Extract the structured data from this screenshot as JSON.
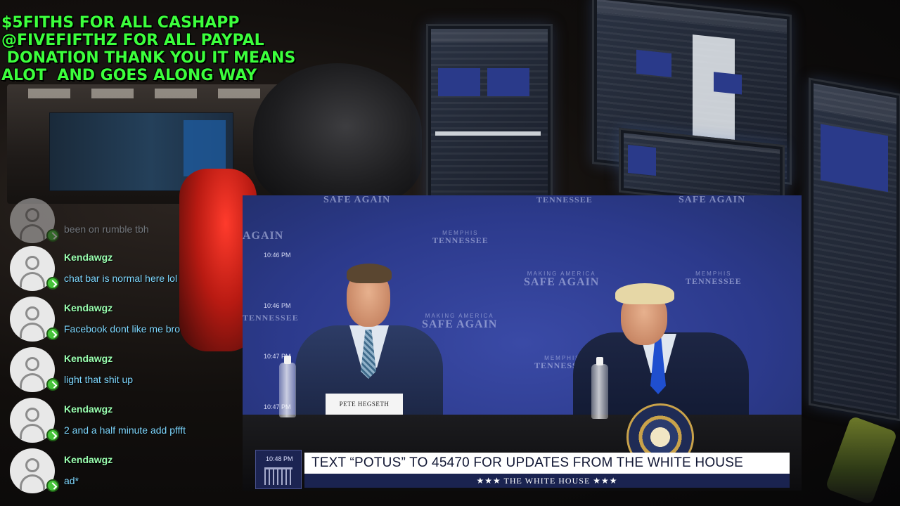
{
  "donation_overlay": {
    "lines": [
      "$5FITHS FOR ALL CASHAPP",
      "@FIVEFIFTHZ FOR ALL PAYPAL",
      " DONATION THANK YOU IT MEANS",
      "ALOT  AND GOES ALONG WAY"
    ],
    "color": "#3cff3c"
  },
  "chat": {
    "messages": [
      {
        "user": "",
        "text": "been on rumble tbh"
      },
      {
        "user": "Kendawgz",
        "text": "chat bar is normal here lol"
      },
      {
        "user": "Kendawgz",
        "text": "Facebook dont like me bro"
      },
      {
        "user": "Kendawgz",
        "text": "light that shit up"
      },
      {
        "user": "Kendawgz",
        "text": "2 and a half minute add pffft"
      },
      {
        "user": "Kendawgz",
        "text": "ad*"
      }
    ],
    "avatar_icon": "user-avatar-icon",
    "status_icon": "online-check-icon",
    "username_color": "#9bffb0",
    "message_color": "#7fd8ff"
  },
  "video": {
    "backdrop": {
      "memphis": "MEMPHIS",
      "tennessee": "TENNESSEE",
      "making_america": "MAKING AMERICA",
      "safe_again": "SAFE AGAIN",
      "again": "AGAIN"
    },
    "timestamps": [
      "10:46 PM",
      "10:46 PM",
      "10:47 PM",
      "10:47 PM"
    ],
    "nameplate": "PETE HEGSETH",
    "lower_third": {
      "time": "10:48 PM",
      "headline": "TEXT “POTUS” TO 45470 FOR UPDATES FROM THE WHITE HOUSE",
      "subtitle": "★★★   THE WHITE HOUSE   ★★★"
    },
    "colors": {
      "backdrop": "#2c3a8c",
      "lower_bar": "#ffffff",
      "lower_sub": "#1a2350"
    }
  }
}
